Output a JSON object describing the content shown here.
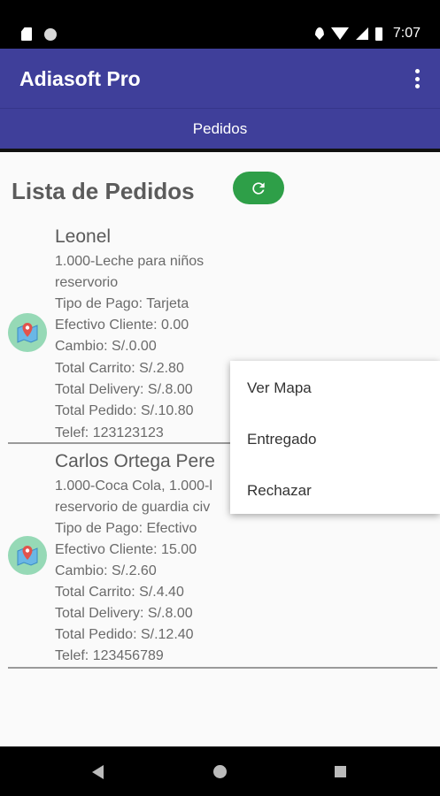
{
  "status_bar": {
    "time": "7:07"
  },
  "app_bar": {
    "title": "Adiasoft Pro"
  },
  "tabs": [
    {
      "label": "Pedidos"
    }
  ],
  "main": {
    "heading": "Lista de Pedidos",
    "orders": [
      {
        "name": "Leonel",
        "items": "1.000-Leche para niños",
        "address": "reservorio",
        "payment": "Tipo de Pago: Tarjeta",
        "cash": "Efectivo Cliente: 0.00",
        "change": "Cambio: S/.0.00",
        "cart_total": "Total Carrito: S/.2.80",
        "delivery_total": "Total Delivery: S/.8.00",
        "order_total": "Total Pedido: S/.10.80",
        "phone": "Telef: 123123123"
      },
      {
        "name": "Carlos Ortega Pere",
        "items": "1.000-Coca Cola, 1.000-l",
        "address": "reservorio de guardia civ",
        "payment": "Tipo de Pago: Efectivo",
        "cash": "Efectivo Cliente: 15.00",
        "change": "Cambio: S/.2.60",
        "cart_total": "Total Carrito: S/.4.40",
        "delivery_total": "Total Delivery: S/.8.00",
        "order_total": "Total Pedido: S/.12.40",
        "phone": "Telef: 123456789"
      }
    ]
  },
  "popup_menu": {
    "items": [
      {
        "label": "Ver Mapa"
      },
      {
        "label": "Entregado"
      },
      {
        "label": "Rechazar"
      }
    ]
  },
  "colors": {
    "app_bar": "#3f3f9a",
    "refresh_button": "#2e9f48",
    "map_avatar": "#96d9b6"
  },
  "icons": {
    "refresh": "refresh-icon",
    "map": "map-pin-icon",
    "overflow": "more-vert-icon"
  }
}
